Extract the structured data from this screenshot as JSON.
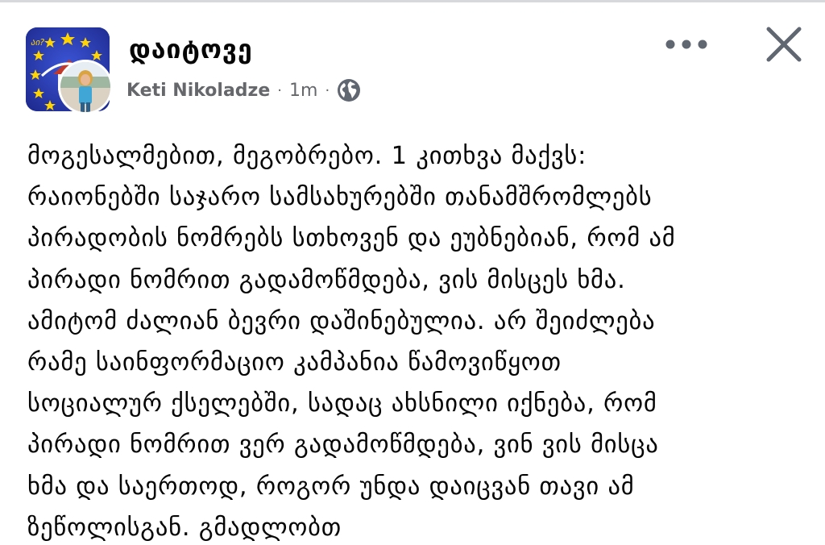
{
  "post": {
    "group_name": "დაიტოვე",
    "author": "Keti Nikoladze",
    "separator": "·",
    "time_ago": "1m",
    "audience_icon": "globe-icon",
    "more_icon": "more-horizontal-icon",
    "close_icon": "close-icon",
    "body_lines": [
      "მოგესალმებით, მეგობრებო. 1 კითხვა მაქვს:",
      "რაიონებში საჯარო სამსახურებში თანამშრომლებს",
      "პირადობის ნომრებს სთხოვენ და ეუბნებიან, რომ ამ",
      "პირადი ნომრით გადამოწმდება, ვის მისცეს ხმა.",
      "ამიტომ ძალიან ბევრი დაშინებულია. არ შეიძლება",
      "რამე საინფორმაციო კამპანია წამოვიწყოთ",
      "სოციალურ ქსელებში, სადაც ახსნილი იქნება, რომ",
      "პირადი ნომრით ვერ გადამოწმდება, ვინ ვის მისცა",
      "ხმა და საერთოდ, როგორ უნდა დაიცვან თავი ამ",
      "ზეწოლისგან. გმადლობთ"
    ]
  },
  "colors": {
    "text_primary": "#050505",
    "text_secondary": "#65676b",
    "icon_gray": "#606770",
    "group_avatar_blue": "#2a3bb0",
    "star_yellow": "#ffd400"
  }
}
